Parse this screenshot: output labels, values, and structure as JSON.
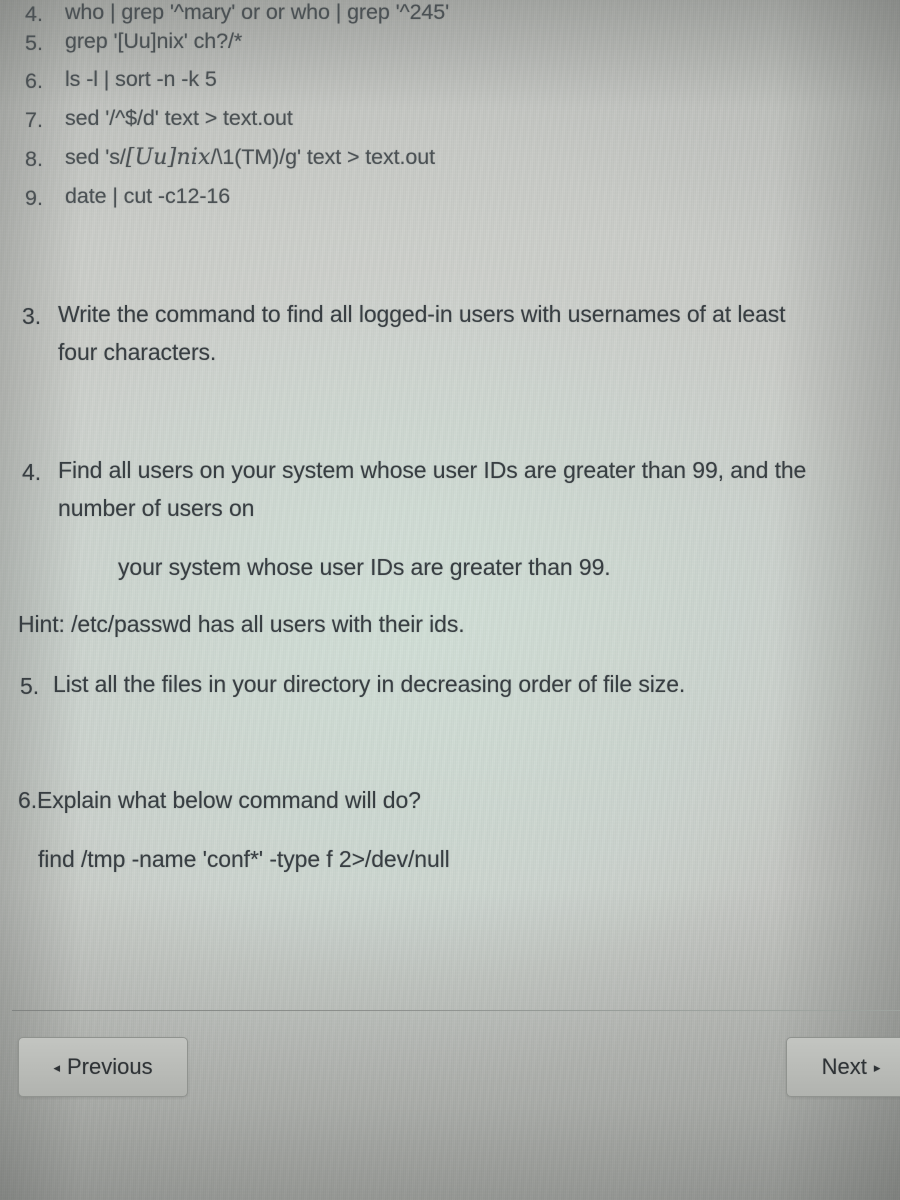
{
  "document": {
    "answer_list": {
      "items": [
        {
          "num": "4.",
          "text": "who | grep '^mary'  or or  who | grep '^245'"
        },
        {
          "num": "5.",
          "text": "grep '[Uu]nix' ch?/*"
        },
        {
          "num": "6.",
          "text": "ls -l | sort -n -k 5"
        },
        {
          "num": "7.",
          "text": "sed '/^$/d' text > text.out"
        },
        {
          "num": "8.",
          "text_before": "sed 's/",
          "text_math": "[Uu]nix",
          "text_after": "/\\1(TM)/g' text > text.out"
        },
        {
          "num": "9.",
          "text": "date | cut -c12-16"
        }
      ]
    },
    "questions": [
      {
        "num": "3.",
        "lines": [
          "Write the command to find all logged-in users with usernames of at least",
          "four characters."
        ]
      },
      {
        "num": "4.",
        "lines": [
          "Find all users on your system whose user IDs are greater than 99, and the",
          "number of users on"
        ],
        "continuation": "your system whose user IDs are greater than 99."
      }
    ],
    "hint": "Hint: /etc/passwd  has all users with their ids.",
    "question5": {
      "num": "5.",
      "text": "List all the files in your directory in decreasing order of file size."
    },
    "question6": {
      "prompt": "6.Explain what below command will do?",
      "command": "find /tmp -name 'conf*' -type f  2>/dev/null"
    }
  },
  "footer": {
    "previous_label": "Previous",
    "next_label": "Next",
    "previous_arrow": "◂",
    "next_arrow": "▸"
  },
  "colors": {
    "text": "#383e42",
    "muted_text": "#4b5154",
    "button_border": "#90938f",
    "divider": "#8b8e8b",
    "background": "#b9bab6"
  }
}
